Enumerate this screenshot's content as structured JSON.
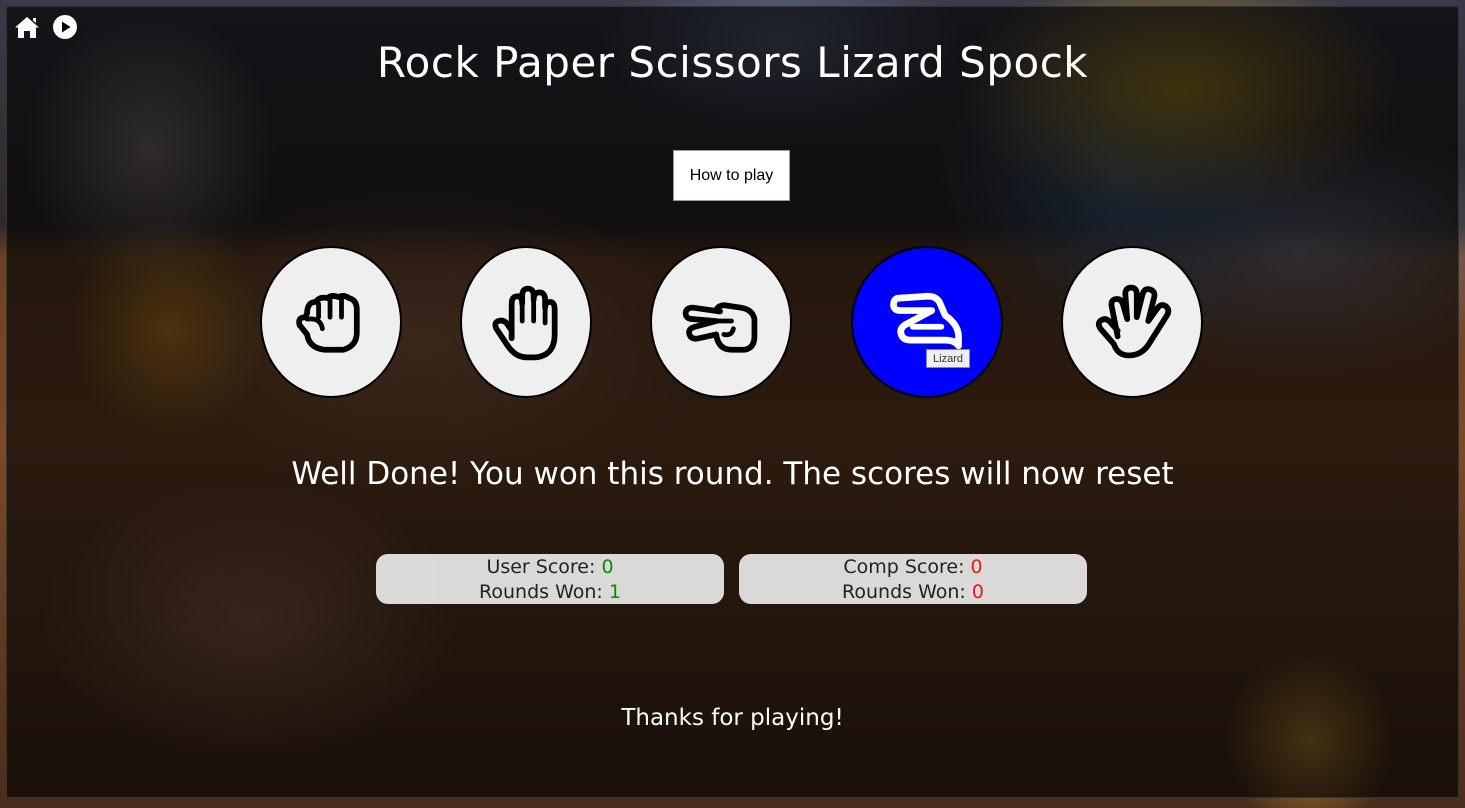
{
  "nav": {
    "home_icon": "home-icon",
    "play_icon": "play-icon"
  },
  "title": "Rock Paper Scissors Lizard Spock",
  "how_to_play": "How to play",
  "choices": [
    {
      "name": "Rock",
      "icon": "rock-hand-icon"
    },
    {
      "name": "Paper",
      "icon": "paper-hand-icon"
    },
    {
      "name": "Scissors",
      "icon": "scissors-hand-icon"
    },
    {
      "name": "Lizard",
      "icon": "lizard-hand-icon",
      "selected": true
    },
    {
      "name": "Spock",
      "icon": "spock-hand-icon"
    }
  ],
  "tooltip": "Lizard",
  "result_message": "Well Done! You won this round. The scores will now reset",
  "user": {
    "score_label": "User Score: ",
    "score": "0",
    "rounds_label": "Rounds Won: ",
    "rounds": "1"
  },
  "comp": {
    "score_label": "Comp Score: ",
    "score": "0",
    "rounds_label": "Rounds Won: ",
    "rounds": "0"
  },
  "footer": "Thanks for playing!",
  "colors": {
    "selected_choice": "#0000ff",
    "user_value": "#0a8a0a",
    "comp_value": "#e21a1a"
  }
}
